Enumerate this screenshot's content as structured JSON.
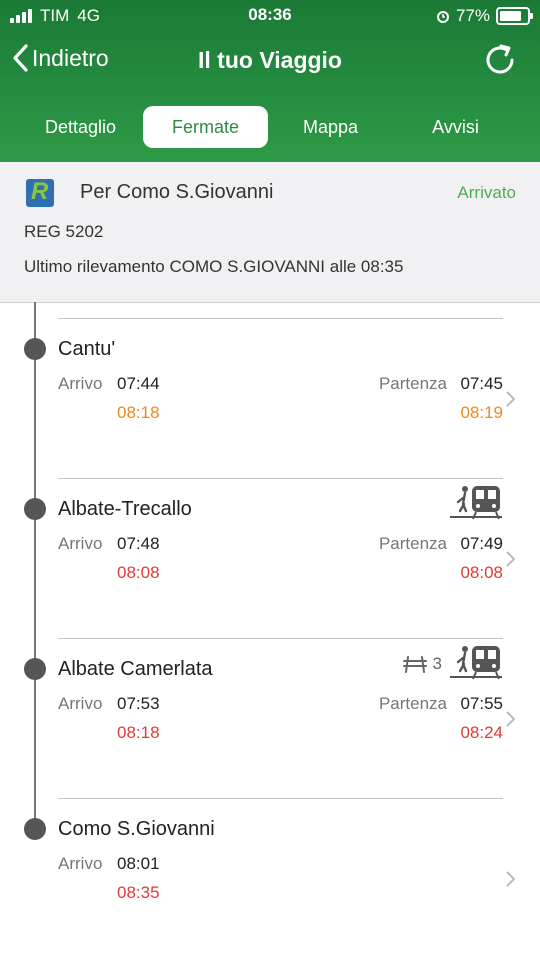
{
  "status_bar": {
    "carrier": "TIM",
    "network": "4G",
    "time": "08:36",
    "battery": "77%"
  },
  "nav": {
    "back_label": "Indietro",
    "title": "Il tuo Viaggio"
  },
  "tabs": [
    {
      "label": "Dettaglio",
      "active": false
    },
    {
      "label": "Fermate",
      "active": true
    },
    {
      "label": "Mappa",
      "active": false
    },
    {
      "label": "Avvisi",
      "active": false
    }
  ],
  "summary": {
    "destination": "Per Como S.Giovanni",
    "state": "Arrivato",
    "train": "REG 5202",
    "last_update": "Ultimo rilevamento COMO S.GIOVANNI alle 08:35"
  },
  "labels": {
    "arrival": "Arrivo",
    "departure": "Partenza"
  },
  "stops": [
    {
      "name": "Cantu'",
      "arrival_sched": "07:44",
      "arrival_actual": "08:18",
      "departure_sched": "07:45",
      "departure_actual": "08:19",
      "delay_color": "#f0881e"
    },
    {
      "name": "Albate-Trecallo",
      "arrival_sched": "07:48",
      "arrival_actual": "08:08",
      "departure_sched": "07:49",
      "departure_actual": "08:08",
      "delay_color": "#e53935",
      "icon": "train-passenger-icon"
    },
    {
      "name": "Albate Camerlata",
      "arrival_sched": "07:53",
      "arrival_actual": "08:18",
      "departure_sched": "07:55",
      "departure_actual": "08:24",
      "delay_color": "#e53935",
      "platform": "3",
      "icon": "train-passenger-icon"
    },
    {
      "name": "Como S.Giovanni",
      "arrival_sched": "08:01",
      "arrival_actual": "08:35",
      "delay_color": "#e53935"
    }
  ],
  "colors": {
    "header_green": "#2e9a47",
    "arrived_green": "#4caf50",
    "orange_delay": "#f0881e",
    "red_delay": "#e53935"
  }
}
